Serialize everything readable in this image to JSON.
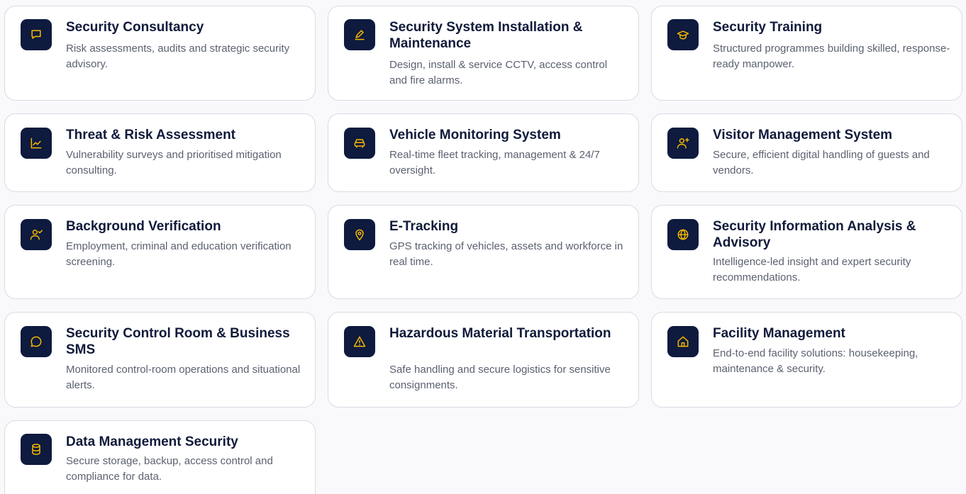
{
  "colors": {
    "icon_bg": "#0e1a3e",
    "icon_stroke": "#f5b800",
    "title": "#101a3a",
    "description": "#5b6170",
    "card_border": "#d9dbe3"
  },
  "services": [
    {
      "title": "Security Consultancy",
      "description": "Risk assessments, audits and strategic security advisory.",
      "icon": "chat-bubble-icon"
    },
    {
      "title": "Security System Installation & Maintenance",
      "description": "Design, install & service CCTV, access control and fire alarms.",
      "icon": "pencil-icon"
    },
    {
      "title": "Security Training",
      "description": "Structured programmes building skilled, response-ready manpower.",
      "icon": "graduation-cap-icon"
    },
    {
      "title": "Threat & Risk Assessment",
      "description": "Vulnerability surveys and prioritised mitigation consulting.",
      "icon": "line-chart-icon"
    },
    {
      "title": "Vehicle Monitoring System",
      "description": "Real-time fleet tracking, management & 24/7 oversight.",
      "icon": "car-icon"
    },
    {
      "title": "Visitor Management System",
      "description": "Secure, efficient digital handling of guests and vendors.",
      "icon": "user-plus-icon"
    },
    {
      "title": "Background Verification",
      "description": "Employment, criminal and education verification screening.",
      "icon": "user-check-icon"
    },
    {
      "title": "E-Tracking",
      "description": "GPS tracking of vehicles, assets and workforce in real time.",
      "icon": "map-pin-icon"
    },
    {
      "title": "Security Information Analysis & Advisory",
      "description": "Intelligence-led insight and expert security recommendations.",
      "icon": "globe-icon"
    },
    {
      "title": "Security Control Room & Business SMS",
      "description": "Monitored control-room operations and situational alerts.",
      "icon": "message-circle-icon"
    },
    {
      "title": "Hazardous Material Transportation",
      "description": "Safe handling and secure logistics for sensitive consignments.",
      "icon": "warning-triangle-icon"
    },
    {
      "title": "Facility Management",
      "description": "End-to-end facility solutions: housekeeping, maintenance & security.",
      "icon": "home-icon"
    },
    {
      "title": "Data Management Security",
      "description": "Secure storage, backup, access control and compliance for data.",
      "icon": "database-icon"
    }
  ]
}
